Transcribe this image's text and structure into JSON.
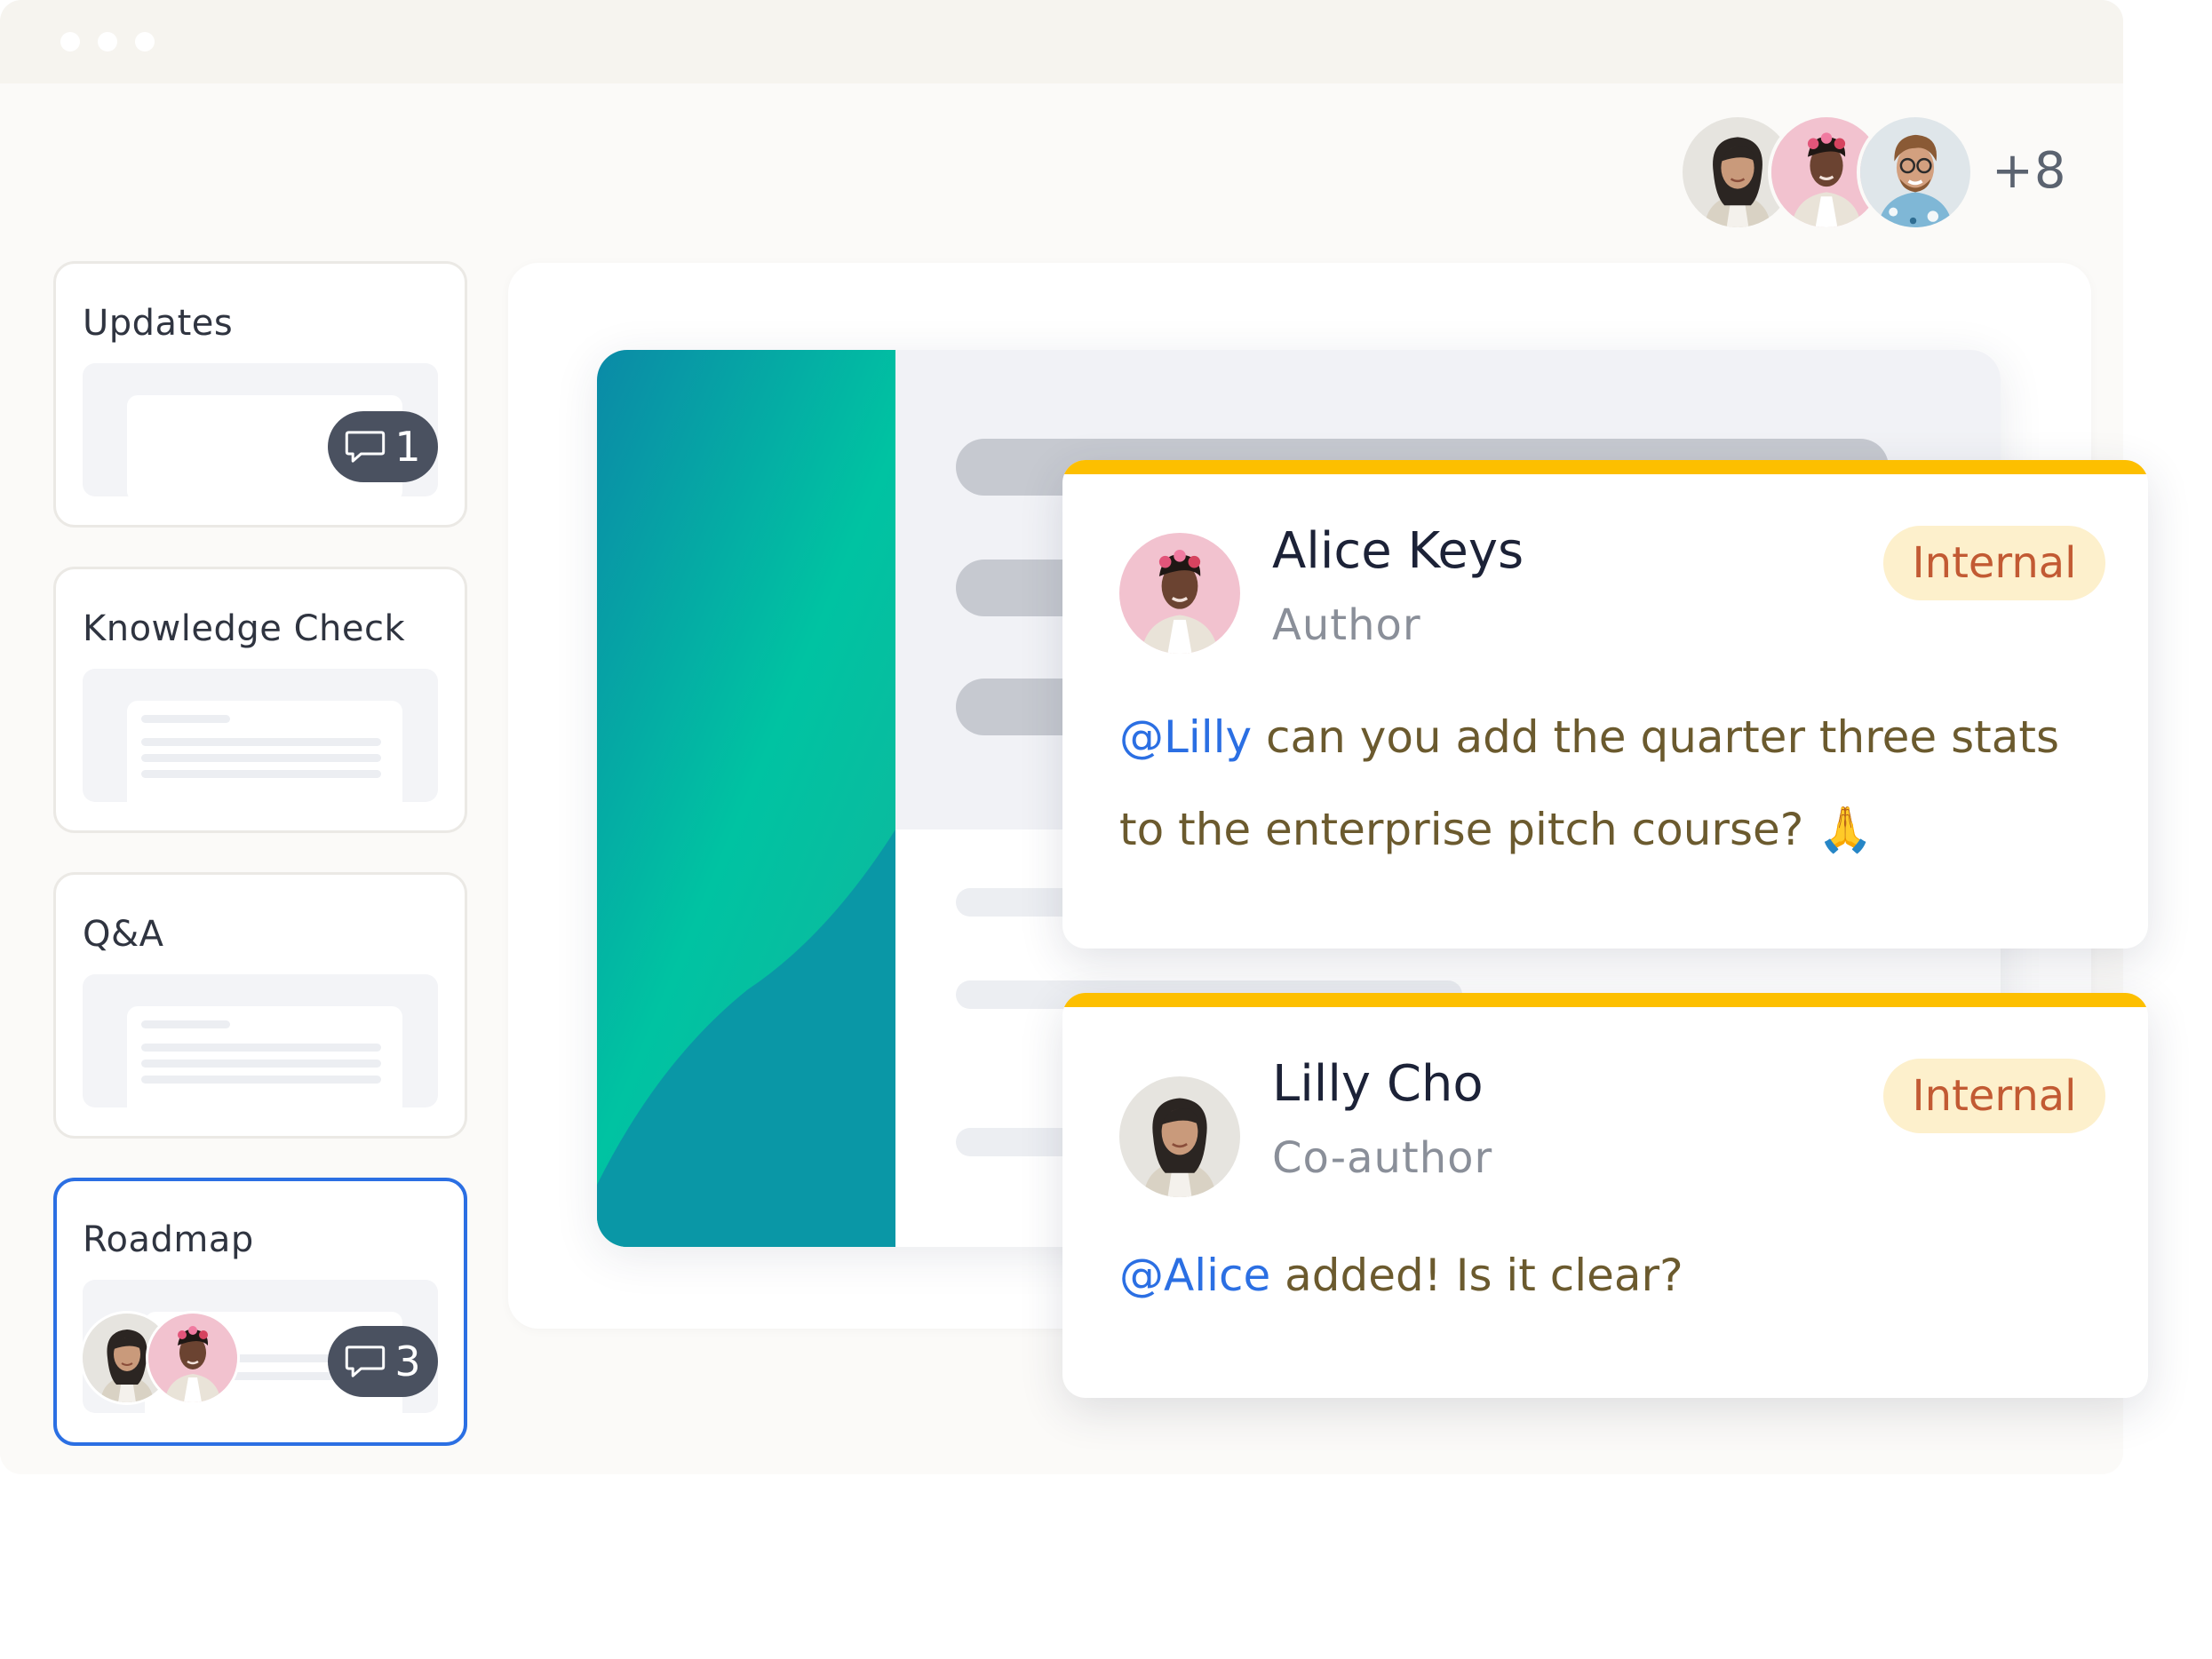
{
  "window": {
    "controls": [
      "dot",
      "dot",
      "dot"
    ]
  },
  "collaborators": {
    "avatars": [
      "woman-dark-hair-avatar",
      "woman-floral-avatar",
      "man-glasses-avatar"
    ],
    "more_count": "+8"
  },
  "sidebar": {
    "cards": [
      {
        "title": "Updates",
        "comment_count": "1"
      },
      {
        "title": "Knowledge Check"
      },
      {
        "title": "Q&A"
      },
      {
        "title": "Roadmap",
        "comment_count": "3",
        "selected": true
      }
    ]
  },
  "comments": [
    {
      "author": "Alice Keys",
      "role": "Author",
      "badge": "Internal",
      "mention": "@Lilly",
      "text_line1": " can you add the quarter three stats",
      "text_line2": "to the enterprise pitch course? 🙏"
    },
    {
      "author": "Lilly Cho",
      "role": "Co-author",
      "badge": "Internal",
      "mention": "@Alice",
      "text_line1": " added! Is it clear?"
    }
  ],
  "colors": {
    "accent_yellow": "#fdbf00",
    "mention_blue": "#2b6fe3",
    "selected_border": "#2b6fe3",
    "badge_bg": "#fdf0cc",
    "badge_text": "#c25a33",
    "cover_teal": "#0a97a6",
    "cover_green": "#00c3a2"
  }
}
